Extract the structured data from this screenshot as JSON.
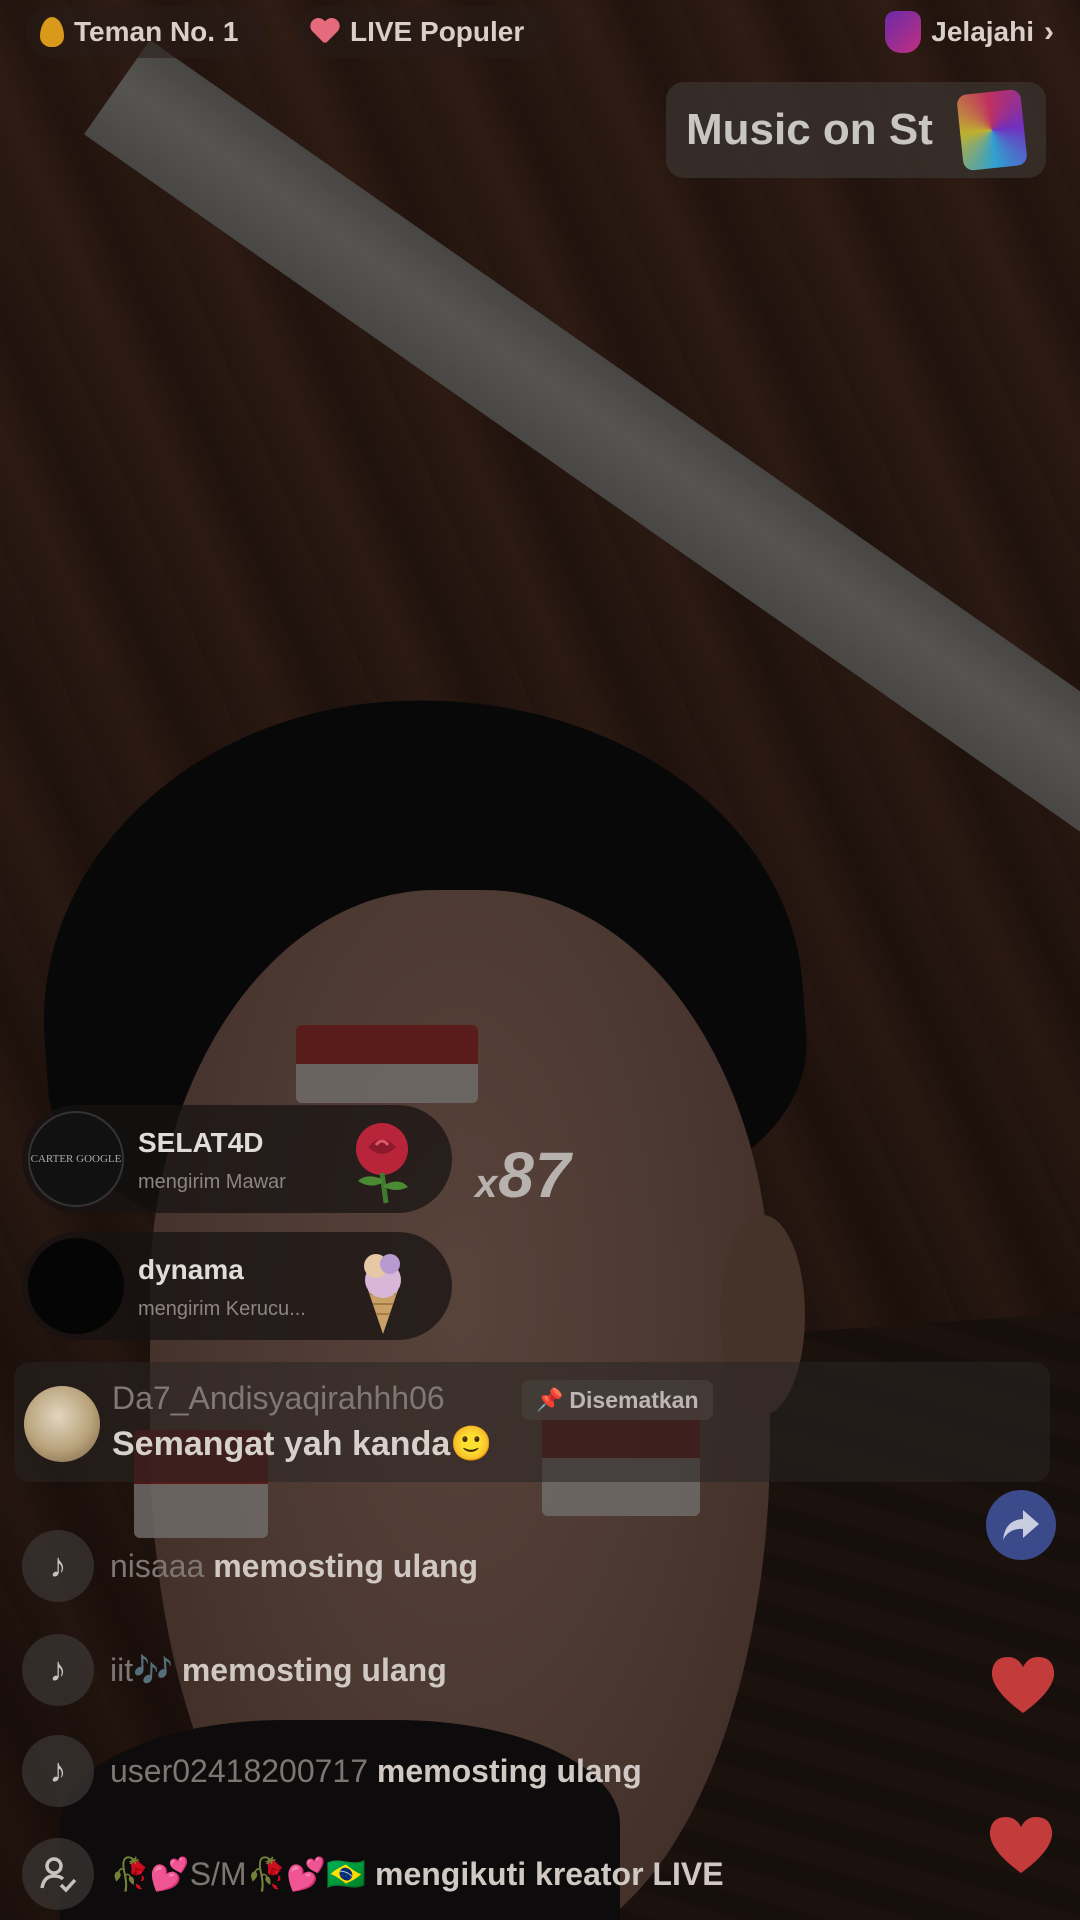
{
  "colors": {
    "overlay_dim": "#000000",
    "heart": "#c43b3b",
    "share_button": "#3a4a8a",
    "flag_red": "#b02a2a",
    "flag_white": "#d8d1cc"
  },
  "top_bar": {
    "friends_pill": {
      "icon": "fire-icon",
      "label": "Teman No. 1"
    },
    "live_pill": {
      "icon": "heart-icon",
      "label": "LIVE Populer"
    },
    "explore": {
      "icon": "explore-icon",
      "label": "Jelajahi",
      "chevron": "›"
    }
  },
  "music_banner": {
    "text": "Music on St",
    "icon": "music-badge-icon"
  },
  "gifts": [
    {
      "user": "SELAT4D",
      "action": "mengirim Mawar",
      "gift_icon": "rose-icon",
      "avatar_text": "CARTER GOOGLE"
    },
    {
      "user": "dynama",
      "action": "mengirim Kerucu...",
      "gift_icon": "ice-cream-cone-icon",
      "avatar_text": ""
    }
  ],
  "gift_combo": {
    "prefix": "x",
    "count": "87"
  },
  "pinned_comment": {
    "user": "Da7_Andisyaqirahhh06",
    "badge": "Disematkan",
    "badge_icon": "📌",
    "text": "Semangat yah kanda🙂"
  },
  "activity_feed": [
    {
      "icon": "tiktok-icon",
      "user": "nisaaa",
      "action": "memosting ulang"
    },
    {
      "icon": "tiktok-icon",
      "user": "iit🎶",
      "action": "memosting ulang"
    },
    {
      "icon": "tiktok-icon",
      "user": "user02418200717",
      "action": "memosting ulang"
    },
    {
      "icon": "follow-icon",
      "user": "🥀💕S/M🥀💕🇧🇷",
      "action": "mengikuti kreator LIVE"
    }
  ]
}
